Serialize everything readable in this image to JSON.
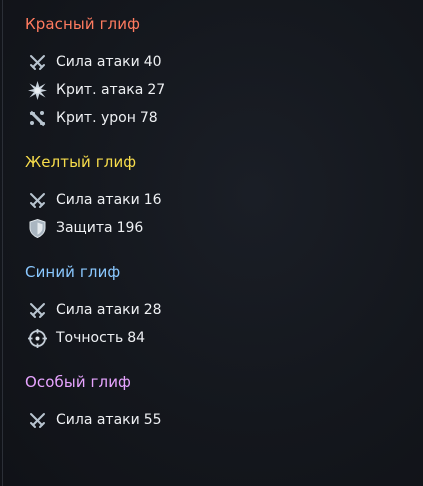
{
  "colors": {
    "red": "#ff7b5f",
    "yellow": "#f7dc4b",
    "blue": "#8ac8ff",
    "special": "#e7a4ff",
    "icon": "#b8c4cf"
  },
  "sections": [
    {
      "title": "Красный глиф",
      "color_key": "red",
      "stats": [
        {
          "icon": "swords-icon",
          "label": "Сила атаки",
          "value": "40"
        },
        {
          "icon": "burst-icon",
          "label": "Крит. атака",
          "value": "27"
        },
        {
          "icon": "crit-damage-icon",
          "label": "Крит. урон",
          "value": "78"
        }
      ]
    },
    {
      "title": "Желтый глиф",
      "color_key": "yellow",
      "stats": [
        {
          "icon": "swords-icon",
          "label": "Сила атаки",
          "value": "16"
        },
        {
          "icon": "shield-icon",
          "label": "Защита",
          "value": "196"
        }
      ]
    },
    {
      "title": "Синий глиф",
      "color_key": "blue",
      "stats": [
        {
          "icon": "swords-icon",
          "label": "Сила атаки",
          "value": "28"
        },
        {
          "icon": "crosshair-icon",
          "label": "Точность",
          "value": "84"
        }
      ]
    },
    {
      "title": "Особый глиф",
      "color_key": "special",
      "stats": [
        {
          "icon": "swords-icon",
          "label": "Сила атаки",
          "value": "55"
        }
      ]
    }
  ]
}
